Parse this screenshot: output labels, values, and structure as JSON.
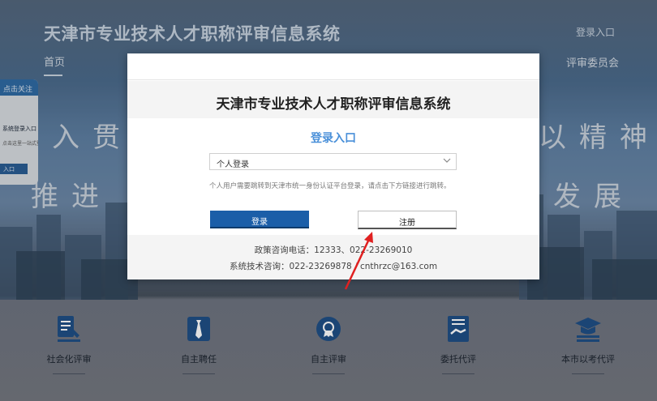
{
  "site": {
    "title": "天津市专业技术人才职称评审信息系统",
    "login_link": "登录入口",
    "nav_home": "首页",
    "nav_committee": "评审委员会",
    "slogan": [
      "入",
      "贯",
      "以",
      "精",
      "神",
      "推",
      "进",
      "发",
      "展"
    ]
  },
  "side_card": {
    "tab": "点击关注",
    "line1": "系统登录入口",
    "line2": "点击这里一站式登录",
    "button": "入口"
  },
  "services": [
    {
      "label": "社会化评审",
      "icon": "document-pen-icon"
    },
    {
      "label": "自主聘任",
      "icon": "tie-icon"
    },
    {
      "label": "自主评审",
      "icon": "medal-icon"
    },
    {
      "label": "委托代评",
      "icon": "handshake-icon"
    },
    {
      "label": "本市以考代评",
      "icon": "graduation-cap-icon"
    }
  ],
  "modal": {
    "title": "天津市专业技术人才职称评审信息系统",
    "entry": "登录入口",
    "select_value": "个人登录",
    "hint": "个人用户需要跳转到天津市统一身份认证平台登录，请点击下方链接进行跳转。",
    "login_button": "登录",
    "register_button": "注册",
    "phone": "政策咨询电话：12333、022-23269010",
    "tech": "系统技术咨询：022-23269878 / cnthrzc@163.com"
  },
  "colors": {
    "accent": "#1b5ea8",
    "entry_title": "#4a90d9",
    "annotation": "#e02020"
  }
}
